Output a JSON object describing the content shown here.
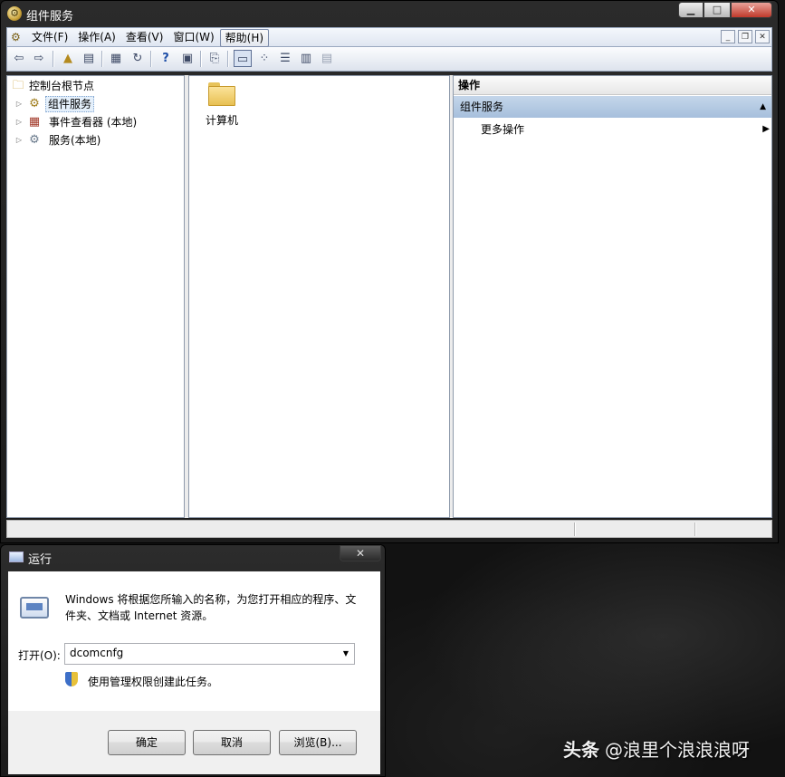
{
  "main_window": {
    "title": "组件服务",
    "caption_buttons": {
      "minimize": "▁",
      "maximize": "□",
      "close": "✕"
    },
    "menu": [
      "文件(F)",
      "操作(A)",
      "查看(V)",
      "窗口(W)",
      "帮助(H)"
    ],
    "menu_active_index": 4,
    "mdi_buttons": {
      "minimize": "_",
      "restore": "❐",
      "close": "✕"
    },
    "toolbar_icons": [
      "back-icon",
      "forward-icon",
      "up-folder-icon",
      "show-hide-tree-icon",
      "properties-icon",
      "refresh-icon",
      "help-icon",
      "action-pane-icon",
      "delete-icon",
      "large-icons-view",
      "small-icons-view",
      "list-view",
      "details-view",
      "configure-icon"
    ]
  },
  "tree": {
    "root": "控制台根节点",
    "items": [
      {
        "label": "组件服务",
        "icon": "component-services-icon",
        "selected": true
      },
      {
        "label": "事件查看器 (本地)",
        "icon": "event-viewer-icon",
        "selected": false
      },
      {
        "label": "服务(本地)",
        "icon": "services-icon",
        "selected": false
      }
    ]
  },
  "content": {
    "items": [
      {
        "label": "计算机",
        "icon": "folder-icon"
      }
    ]
  },
  "actions": {
    "header": "操作",
    "section": "组件服务",
    "items": [
      "更多操作"
    ]
  },
  "run_dialog": {
    "title": "运行",
    "close": "✕",
    "description": "Windows 将根据您所输入的名称，为您打开相应的程序、文件夹、文档或 Internet 资源。",
    "open_label": "打开(O):",
    "open_value": "dcomcnfg",
    "admin_note": "使用管理权限创建此任务。",
    "buttons": {
      "ok": "确定",
      "cancel": "取消",
      "browse": "浏览(B)..."
    }
  },
  "watermark": {
    "brand": "头条",
    "handle": "@浪里个浪浪浪呀"
  },
  "colors": {
    "section_header": "#a6bfdc",
    "title_bar": "#1c1c1c",
    "selection": "#e5f0fb"
  }
}
